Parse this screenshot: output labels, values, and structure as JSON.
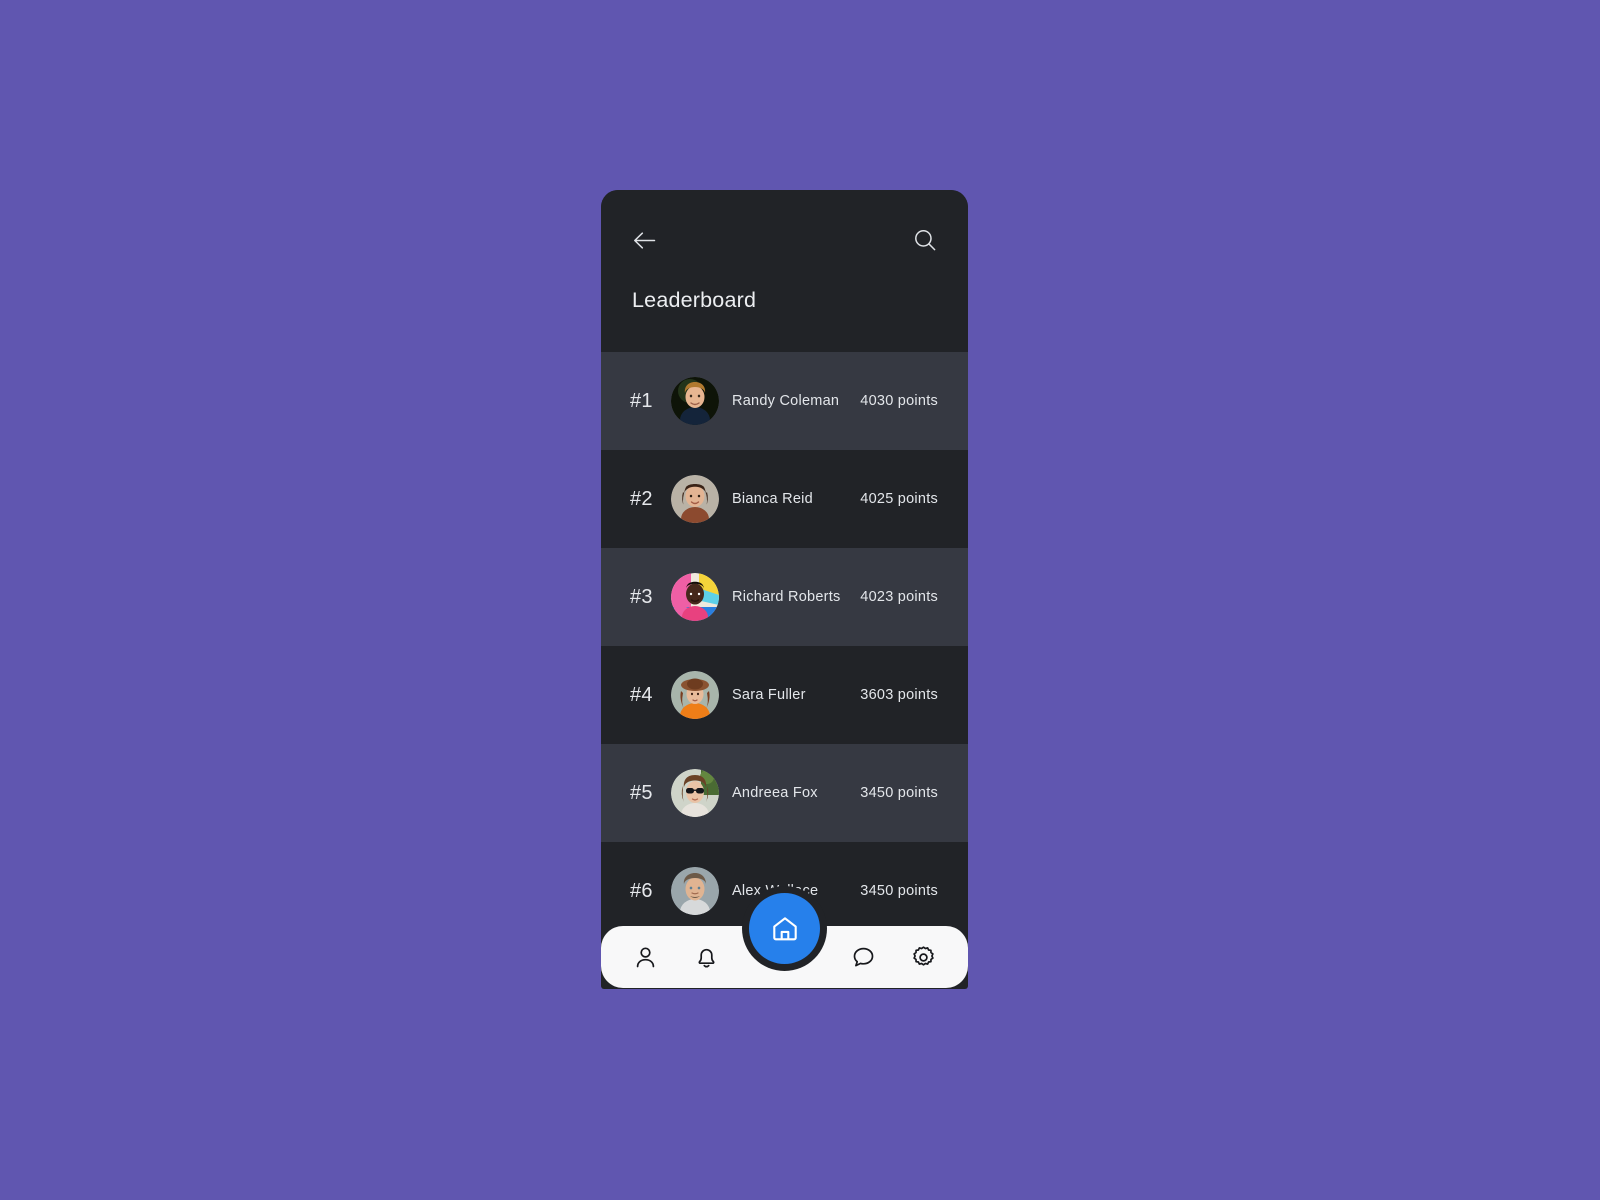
{
  "theme": {
    "page_background": "#6056b0",
    "card_background": "#212327",
    "row_alt_background": "#363942",
    "accent": "#2680eb",
    "nav_background": "#f8f8f9",
    "text_primary": "#e6e8ec"
  },
  "header": {
    "back_icon": "arrow-left-icon",
    "search_icon": "search-icon",
    "title": "Leaderboard"
  },
  "leaderboard": {
    "rows": [
      {
        "rank": "#1",
        "name": "Randy Coleman",
        "points": "4030  points",
        "avatar": "avatar-randy-coleman"
      },
      {
        "rank": "#2",
        "name": "Bianca Reid",
        "points": "4025  points",
        "avatar": "avatar-bianca-reid"
      },
      {
        "rank": "#3",
        "name": "Richard Roberts",
        "points": "4023  points",
        "avatar": "avatar-richard-roberts"
      },
      {
        "rank": "#4",
        "name": "Sara Fuller",
        "points": "3603 points",
        "avatar": "avatar-sara-fuller"
      },
      {
        "rank": "#5",
        "name": "Andreea Fox",
        "points": "3450 points",
        "avatar": "avatar-andreea-fox"
      },
      {
        "rank": "#6",
        "name": "Alex Wallace",
        "points": "3450 points",
        "avatar": "avatar-alex-wallace"
      }
    ]
  },
  "bottom_nav": {
    "items": [
      {
        "icon": "person-icon",
        "name": "profile"
      },
      {
        "icon": "bell-icon",
        "name": "notifications"
      },
      {
        "icon": "chat-icon",
        "name": "messages"
      },
      {
        "icon": "gear-icon",
        "name": "settings"
      }
    ],
    "fab": {
      "icon": "home-icon",
      "name": "home"
    }
  }
}
